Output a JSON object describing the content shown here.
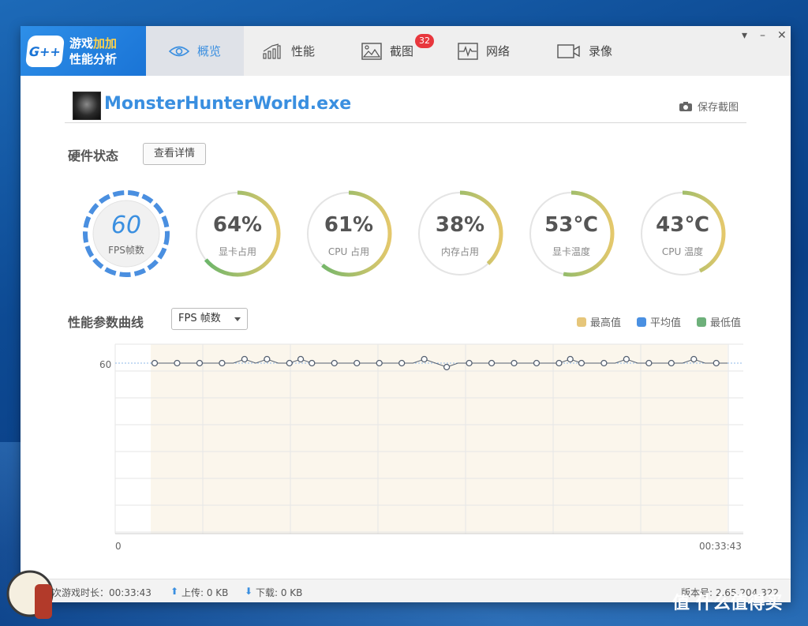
{
  "window": {
    "logo": {
      "badge": "G++",
      "line1_a": "游戏",
      "line1_b": "加加",
      "line2": "性能分析"
    },
    "tabs": [
      {
        "label": "概览",
        "icon": "eye-icon",
        "active": true
      },
      {
        "label": "性能",
        "icon": "bar-chart-icon"
      },
      {
        "label": "截图",
        "icon": "image-icon",
        "badge": "32"
      },
      {
        "label": "网络",
        "icon": "pulse-icon"
      },
      {
        "label": "录像",
        "icon": "video-icon"
      }
    ],
    "controls": {
      "menu": "▾",
      "minimize": "–",
      "close": "✕"
    }
  },
  "header": {
    "game_title": "MonsterHunterWorld.exe",
    "save_screenshot": "保存截图"
  },
  "hardware": {
    "title": "硬件状态",
    "detail_button": "查看详情",
    "gauges": [
      {
        "value": "60",
        "label": "FPS帧数",
        "fraction": 1.0
      },
      {
        "value": "64%",
        "label": "显卡占用",
        "fraction": 0.64
      },
      {
        "value": "61%",
        "label": "CPU 占用",
        "fraction": 0.61
      },
      {
        "value": "38%",
        "label": "内存占用",
        "fraction": 0.38
      },
      {
        "value": "53℃",
        "label": "显卡温度",
        "fraction": 0.53
      },
      {
        "value": "43℃",
        "label": "CPU 温度",
        "fraction": 0.43
      }
    ]
  },
  "curve": {
    "title": "性能参数曲线",
    "metric_select": "FPS 帧数",
    "legend": [
      {
        "label": "最高值",
        "color": "#e6c67a"
      },
      {
        "label": "平均值",
        "color": "#4a90e2"
      },
      {
        "label": "最低值",
        "color": "#6db07a"
      }
    ]
  },
  "chart_data": {
    "type": "line",
    "ylabel": "",
    "xlabel": "",
    "y_ticks": [
      "60"
    ],
    "x_start_label": "0",
    "x_end_label": "00:33:43",
    "average": 60,
    "ylim": [
      0,
      62
    ],
    "series": [
      {
        "values": [
          60,
          60,
          60,
          60,
          60,
          60,
          60,
          60,
          61,
          60,
          61,
          60,
          60,
          61,
          60,
          60,
          60,
          60,
          60,
          60,
          60,
          60,
          60,
          60,
          61,
          60,
          59,
          60,
          60,
          60,
          60,
          60,
          60,
          60,
          60,
          60,
          60,
          61,
          60,
          60,
          60,
          60,
          61,
          60,
          60,
          60,
          60,
          60,
          61,
          60,
          60,
          60
        ]
      }
    ]
  },
  "status": {
    "play_time": "本次游戏时长：00:33:43",
    "upload": "上传: 0 KB",
    "download": "下载: 0 KB",
    "version": "版本号: 2.65.204.322"
  },
  "watermark": {
    "text": "值 什么值得买"
  }
}
